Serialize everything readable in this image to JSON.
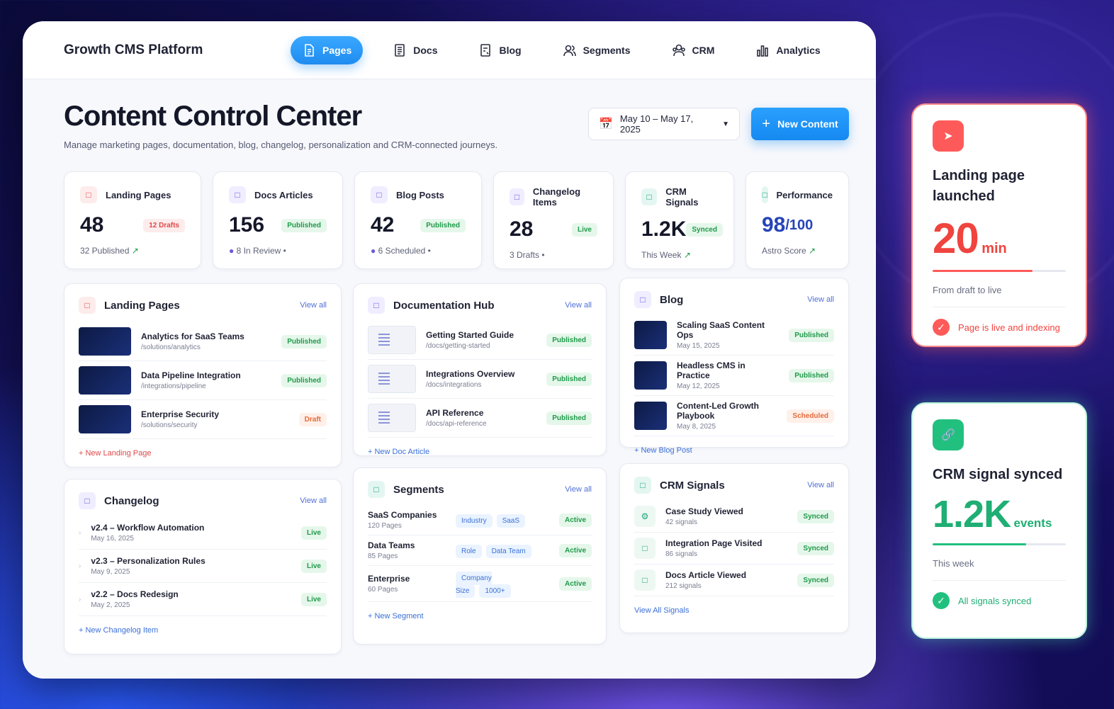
{
  "brand": "Growth CMS Platform",
  "nav": [
    {
      "label": "Pages"
    },
    {
      "label": "Docs"
    },
    {
      "label": "Blog"
    },
    {
      "label": "Segments"
    },
    {
      "label": "CRM"
    },
    {
      "label": "Analytics"
    }
  ],
  "header": {
    "title": "Content Control Center",
    "subtitle": "Manage marketing pages, documentation, blog, changelog, personalization and CRM-connected journeys.",
    "date_range": "May 10 – May 17, 2025",
    "new_button": "New Content"
  },
  "stats": [
    {
      "title": "Landing Pages",
      "value": "48",
      "badge": "12 Drafts",
      "sub": "32 Published"
    },
    {
      "title": "Docs Articles",
      "value": "156",
      "badge": "Published",
      "sub": "8 In Review"
    },
    {
      "title": "Blog Posts",
      "value": "42",
      "badge": "Published",
      "sub": "6 Scheduled"
    },
    {
      "title": "Changelog Items",
      "value": "28",
      "badge": "Live",
      "sub": "3 Drafts"
    },
    {
      "title": "CRM Signals",
      "value": "1.2K",
      "badge": "Synced",
      "sub": "This Week"
    },
    {
      "title": "Performance",
      "value": "98",
      "value_suffix": "/100",
      "sub": "Astro Score"
    }
  ],
  "view_all": "View all",
  "landing": {
    "title": "Landing Pages",
    "add": "New Landing Page",
    "rows": [
      {
        "name": "Analytics for SaaS Teams",
        "path": "/solutions/analytics",
        "status": "Published"
      },
      {
        "name": "Data Pipeline Integration",
        "path": "/integrations/pipeline",
        "status": "Published"
      },
      {
        "name": "Enterprise Security",
        "path": "/solutions/security",
        "status": "Draft"
      }
    ]
  },
  "docs": {
    "title": "Documentation Hub",
    "add": "New Doc Article",
    "rows": [
      {
        "name": "Getting Started Guide",
        "path": "/docs/getting-started",
        "status": "Published"
      },
      {
        "name": "Integrations Overview",
        "path": "/docs/integrations",
        "status": "Published"
      },
      {
        "name": "API Reference",
        "path": "/docs/api-reference",
        "status": "Published"
      }
    ]
  },
  "blog": {
    "title": "Blog",
    "add": "New Blog Post",
    "rows": [
      {
        "name": "Scaling SaaS Content Ops",
        "date": "May 15, 2025",
        "status": "Published"
      },
      {
        "name": "Headless CMS in Practice",
        "date": "May 12, 2025",
        "status": "Published"
      },
      {
        "name": "Content-Led Growth Playbook",
        "date": "May 8, 2025",
        "status": "Scheduled"
      }
    ]
  },
  "changelog": {
    "title": "Changelog",
    "add": "New Changelog Item",
    "rows": [
      {
        "name": "v2.4 – Workflow Automation",
        "date": "May 16, 2025",
        "status": "Live"
      },
      {
        "name": "v2.3 – Personalization Rules",
        "date": "May 9, 2025",
        "status": "Live"
      },
      {
        "name": "v2.2 – Docs Redesign",
        "date": "May 2, 2025",
        "status": "Live"
      }
    ]
  },
  "segments": {
    "title": "Segments",
    "add": "New Segment",
    "rows": [
      {
        "name": "SaaS Companies",
        "count": "120 Pages",
        "tags": [
          "Industry",
          "SaaS"
        ],
        "status": "Active"
      },
      {
        "name": "Data Teams",
        "count": "85 Pages",
        "tags": [
          "Role",
          "Data Team"
        ],
        "status": "Active"
      },
      {
        "name": "Enterprise",
        "count": "60 Pages",
        "tags": [
          "Company Size",
          "1000+"
        ],
        "status": "Active"
      }
    ]
  },
  "crm": {
    "title": "CRM Signals",
    "add": "View All Signals",
    "rows": [
      {
        "name": "Case Study Viewed",
        "count": "42 signals",
        "status": "Synced"
      },
      {
        "name": "Integration Page Visited",
        "count": "86 signals",
        "status": "Synced"
      },
      {
        "name": "Docs Article Viewed",
        "count": "212 signals",
        "status": "Synced"
      }
    ]
  },
  "card1": {
    "title": "Landing page launched",
    "value": "20",
    "unit": "min",
    "progress": 0.75,
    "label": "From draft to live",
    "foot": "Page is live and indexing"
  },
  "card2": {
    "title": "CRM signal synced",
    "value": "1.2K",
    "unit": "events",
    "progress": 0.7,
    "label": "This week",
    "foot": "All signals synced"
  }
}
